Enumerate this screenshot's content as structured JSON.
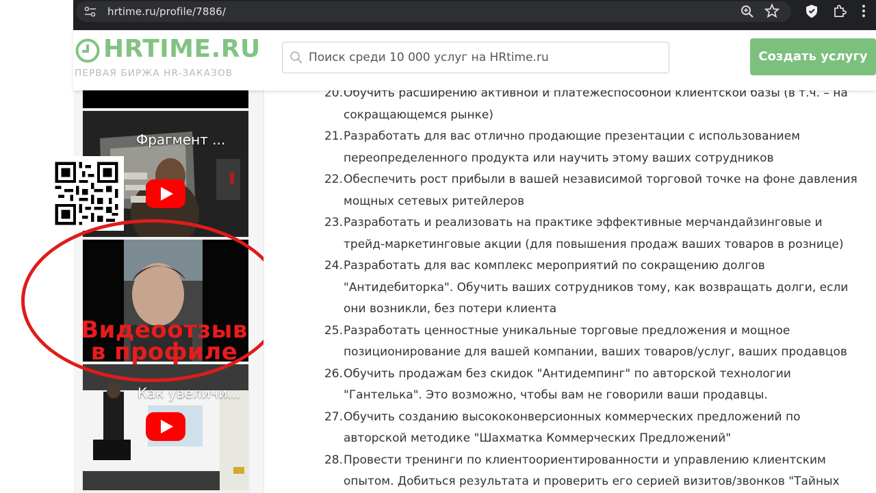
{
  "browser": {
    "url": "hrtime.ru/profile/7886/",
    "icons": [
      "site-settings-icon",
      "zoom-icon",
      "bookmark-star-icon",
      "shield-icon",
      "extensions-icon",
      "menu-dots-icon"
    ]
  },
  "header": {
    "logo_text": "HRTIME.RU",
    "logo_tagline": "ПЕРВАЯ БИРЖА HR-ЗАКАЗОВ",
    "search_placeholder": "Поиск среди 10 000 услуг на HRtime.ru",
    "create_button": "Создать услугу",
    "brand_color": "#7cc07e"
  },
  "sidebar": {
    "videos": [
      {
        "title": "Фрагмент ..."
      },
      {
        "title": ""
      },
      {
        "title": "Как увеличи..."
      }
    ],
    "overlay_caption_line1": "Видеоотзыв",
    "overlay_caption_line2": "в профиле",
    "accent_color": "#e01b1b"
  },
  "services": [
    {
      "num": "20.",
      "text": "Обучить расширению активной и платежеспособной клиентской базы (в т.ч. – на сокращающемся рынке)"
    },
    {
      "num": "21.",
      "text": "Разработать для вас отлично продающие презентации с использованием переопределенного продукта или научить этому ваших сотрудников"
    },
    {
      "num": "22.",
      "text": "Обеспечить рост прибыли в вашей независимой торговой точке на фоне давления мощных сетевых ритейлеров"
    },
    {
      "num": "23.",
      "text": "Разработать и реализовать на практике эффективные мерчандайзинговые и трейд-маркетинговые акции (для повышения продаж ваших товаров в рознице)"
    },
    {
      "num": "24.",
      "text": "Разработать для вас комплекс мероприятий по сокращению долгов \"Антидебиторка\". Обучить ваших сотрудников тому, как возвращать долги, если они возникли, без потери клиента"
    },
    {
      "num": "25.",
      "text": "Разработать ценностные уникальные торговые предложения и мощное позиционирование для вашей компании, ваших товаров/услуг, ваших продавцов"
    },
    {
      "num": "26.",
      "text": "Обучить продажам без скидок \"Антидемпинг\" по авторской технологии \"Гантелька\". Это возможно, чтобы вам не говорили ваши продавцы."
    },
    {
      "num": "27.",
      "text": "Обучить созданию высококонверсионных коммерческих предложений по авторской методике \"Шахматка Коммерческих Предложений\""
    },
    {
      "num": "28.",
      "text": "Провести тренинги по клиентоориентированности и управлению клиентским опытом. Добиться результата и проверить его серией визитов/звонков \"Тайных"
    }
  ]
}
